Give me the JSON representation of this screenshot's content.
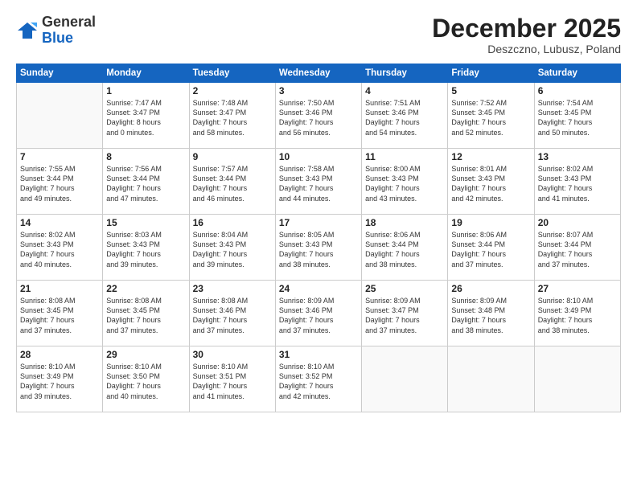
{
  "logo": {
    "general": "General",
    "blue": "Blue"
  },
  "calendar": {
    "title": "December 2025",
    "subtitle": "Deszczno, Lubusz, Poland"
  },
  "headers": [
    "Sunday",
    "Monday",
    "Tuesday",
    "Wednesday",
    "Thursday",
    "Friday",
    "Saturday"
  ],
  "rows": [
    [
      {
        "day": "",
        "lines": []
      },
      {
        "day": "1",
        "lines": [
          "Sunrise: 7:47 AM",
          "Sunset: 3:47 PM",
          "Daylight: 8 hours",
          "and 0 minutes."
        ]
      },
      {
        "day": "2",
        "lines": [
          "Sunrise: 7:48 AM",
          "Sunset: 3:47 PM",
          "Daylight: 7 hours",
          "and 58 minutes."
        ]
      },
      {
        "day": "3",
        "lines": [
          "Sunrise: 7:50 AM",
          "Sunset: 3:46 PM",
          "Daylight: 7 hours",
          "and 56 minutes."
        ]
      },
      {
        "day": "4",
        "lines": [
          "Sunrise: 7:51 AM",
          "Sunset: 3:46 PM",
          "Daylight: 7 hours",
          "and 54 minutes."
        ]
      },
      {
        "day": "5",
        "lines": [
          "Sunrise: 7:52 AM",
          "Sunset: 3:45 PM",
          "Daylight: 7 hours",
          "and 52 minutes."
        ]
      },
      {
        "day": "6",
        "lines": [
          "Sunrise: 7:54 AM",
          "Sunset: 3:45 PM",
          "Daylight: 7 hours",
          "and 50 minutes."
        ]
      }
    ],
    [
      {
        "day": "7",
        "lines": [
          "Sunrise: 7:55 AM",
          "Sunset: 3:44 PM",
          "Daylight: 7 hours",
          "and 49 minutes."
        ]
      },
      {
        "day": "8",
        "lines": [
          "Sunrise: 7:56 AM",
          "Sunset: 3:44 PM",
          "Daylight: 7 hours",
          "and 47 minutes."
        ]
      },
      {
        "day": "9",
        "lines": [
          "Sunrise: 7:57 AM",
          "Sunset: 3:44 PM",
          "Daylight: 7 hours",
          "and 46 minutes."
        ]
      },
      {
        "day": "10",
        "lines": [
          "Sunrise: 7:58 AM",
          "Sunset: 3:43 PM",
          "Daylight: 7 hours",
          "and 44 minutes."
        ]
      },
      {
        "day": "11",
        "lines": [
          "Sunrise: 8:00 AM",
          "Sunset: 3:43 PM",
          "Daylight: 7 hours",
          "and 43 minutes."
        ]
      },
      {
        "day": "12",
        "lines": [
          "Sunrise: 8:01 AM",
          "Sunset: 3:43 PM",
          "Daylight: 7 hours",
          "and 42 minutes."
        ]
      },
      {
        "day": "13",
        "lines": [
          "Sunrise: 8:02 AM",
          "Sunset: 3:43 PM",
          "Daylight: 7 hours",
          "and 41 minutes."
        ]
      }
    ],
    [
      {
        "day": "14",
        "lines": [
          "Sunrise: 8:02 AM",
          "Sunset: 3:43 PM",
          "Daylight: 7 hours",
          "and 40 minutes."
        ]
      },
      {
        "day": "15",
        "lines": [
          "Sunrise: 8:03 AM",
          "Sunset: 3:43 PM",
          "Daylight: 7 hours",
          "and 39 minutes."
        ]
      },
      {
        "day": "16",
        "lines": [
          "Sunrise: 8:04 AM",
          "Sunset: 3:43 PM",
          "Daylight: 7 hours",
          "and 39 minutes."
        ]
      },
      {
        "day": "17",
        "lines": [
          "Sunrise: 8:05 AM",
          "Sunset: 3:43 PM",
          "Daylight: 7 hours",
          "and 38 minutes."
        ]
      },
      {
        "day": "18",
        "lines": [
          "Sunrise: 8:06 AM",
          "Sunset: 3:44 PM",
          "Daylight: 7 hours",
          "and 38 minutes."
        ]
      },
      {
        "day": "19",
        "lines": [
          "Sunrise: 8:06 AM",
          "Sunset: 3:44 PM",
          "Daylight: 7 hours",
          "and 37 minutes."
        ]
      },
      {
        "day": "20",
        "lines": [
          "Sunrise: 8:07 AM",
          "Sunset: 3:44 PM",
          "Daylight: 7 hours",
          "and 37 minutes."
        ]
      }
    ],
    [
      {
        "day": "21",
        "lines": [
          "Sunrise: 8:08 AM",
          "Sunset: 3:45 PM",
          "Daylight: 7 hours",
          "and 37 minutes."
        ]
      },
      {
        "day": "22",
        "lines": [
          "Sunrise: 8:08 AM",
          "Sunset: 3:45 PM",
          "Daylight: 7 hours",
          "and 37 minutes."
        ]
      },
      {
        "day": "23",
        "lines": [
          "Sunrise: 8:08 AM",
          "Sunset: 3:46 PM",
          "Daylight: 7 hours",
          "and 37 minutes."
        ]
      },
      {
        "day": "24",
        "lines": [
          "Sunrise: 8:09 AM",
          "Sunset: 3:46 PM",
          "Daylight: 7 hours",
          "and 37 minutes."
        ]
      },
      {
        "day": "25",
        "lines": [
          "Sunrise: 8:09 AM",
          "Sunset: 3:47 PM",
          "Daylight: 7 hours",
          "and 37 minutes."
        ]
      },
      {
        "day": "26",
        "lines": [
          "Sunrise: 8:09 AM",
          "Sunset: 3:48 PM",
          "Daylight: 7 hours",
          "and 38 minutes."
        ]
      },
      {
        "day": "27",
        "lines": [
          "Sunrise: 8:10 AM",
          "Sunset: 3:49 PM",
          "Daylight: 7 hours",
          "and 38 minutes."
        ]
      }
    ],
    [
      {
        "day": "28",
        "lines": [
          "Sunrise: 8:10 AM",
          "Sunset: 3:49 PM",
          "Daylight: 7 hours",
          "and 39 minutes."
        ]
      },
      {
        "day": "29",
        "lines": [
          "Sunrise: 8:10 AM",
          "Sunset: 3:50 PM",
          "Daylight: 7 hours",
          "and 40 minutes."
        ]
      },
      {
        "day": "30",
        "lines": [
          "Sunrise: 8:10 AM",
          "Sunset: 3:51 PM",
          "Daylight: 7 hours",
          "and 41 minutes."
        ]
      },
      {
        "day": "31",
        "lines": [
          "Sunrise: 8:10 AM",
          "Sunset: 3:52 PM",
          "Daylight: 7 hours",
          "and 42 minutes."
        ]
      },
      {
        "day": "",
        "lines": []
      },
      {
        "day": "",
        "lines": []
      },
      {
        "day": "",
        "lines": []
      }
    ]
  ]
}
